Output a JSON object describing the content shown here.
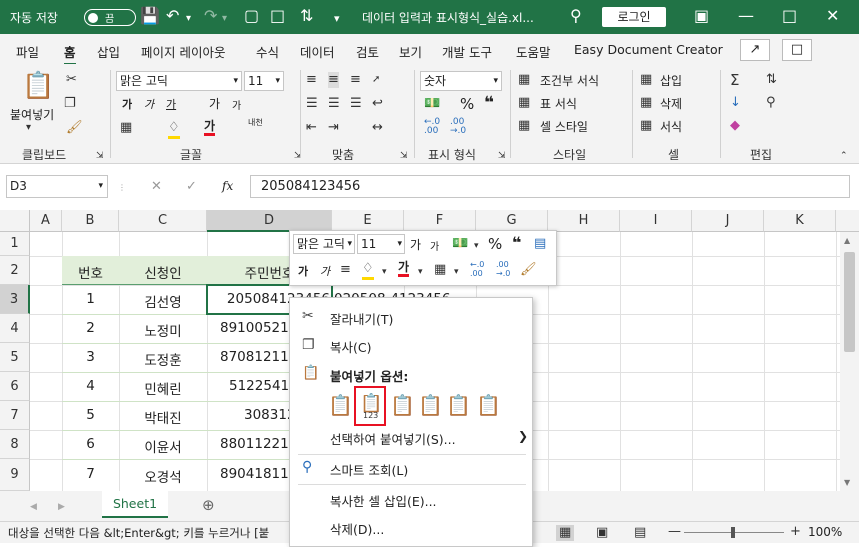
{
  "titlebar": {
    "autosave_label": "자동 저장",
    "autosave_state": "끔",
    "document_title": "데이터 입력과 표시형식_실습.xl...",
    "login_label": "로그인"
  },
  "menu": {
    "items": [
      "파일",
      "홈",
      "삽입",
      "페이지 레이아웃",
      "수식",
      "데이터",
      "검토",
      "보기",
      "개발 도구",
      "도움말",
      "Easy Document Creator"
    ],
    "active": "홈"
  },
  "ribbon": {
    "clipboard": {
      "paste_label": "붙여넣기",
      "group_label": "클립보드"
    },
    "font": {
      "font_name": "맑은 고딕",
      "font_size": "11",
      "group_label": "글꼴",
      "ga_label": "가",
      "phonetic_label": "내천"
    },
    "alignment": {
      "group_label": "맞춤"
    },
    "number": {
      "format": "숫자",
      "group_label": "표시 형식"
    },
    "styles": {
      "cond_format": "조건부 서식",
      "table_format": "표 서식",
      "cell_style": "셀 스타일",
      "group_label": "스타일"
    },
    "cells": {
      "insert": "삽입",
      "delete": "삭제",
      "format": "서식",
      "group_label": "셀"
    },
    "editing": {
      "group_label": "편집"
    }
  },
  "formula_bar": {
    "name_box": "D3",
    "fx_label": "fx",
    "value": "205084123456"
  },
  "columns": [
    "A",
    "B",
    "C",
    "D",
    "E",
    "F",
    "G",
    "H",
    "I",
    "J",
    "K"
  ],
  "rows": [
    "1",
    "2",
    "3",
    "4",
    "5",
    "6",
    "7",
    "8",
    "9"
  ],
  "table": {
    "headers": [
      "번호",
      "신청인",
      "주민번호"
    ],
    "data": [
      [
        "1",
        "김선영",
        "205084123456",
        "020508-4123456"
      ],
      [
        "2",
        "노정미",
        "891005212",
        ""
      ],
      [
        "3",
        "도정훈",
        "870812112",
        ""
      ],
      [
        "4",
        "민혜린",
        "51225412",
        ""
      ],
      [
        "5",
        "박태진",
        "308312",
        ""
      ],
      [
        "6",
        "이윤서",
        "880112212",
        ""
      ],
      [
        "7",
        "오경석",
        "890418112",
        ""
      ]
    ]
  },
  "mini_toolbar": {
    "font_name": "맑은 고딕",
    "font_size": "11"
  },
  "context_menu": {
    "cut": "잘라내기(T)",
    "copy": "복사(C)",
    "paste_options": "붙여넣기 옵션:",
    "paste_special": "선택하여 붙여넣기(S)...",
    "smart_lookup": "스마트 조회(L)",
    "insert_copied": "복사한 셀 삽입(E)...",
    "delete": "삭제(D)..."
  },
  "sheet_tab": "Sheet1",
  "status": {
    "message": "대상을 선택한 다음 &lt;Enter&gt; 키를 누르거나 [붙",
    "zoom": "100%"
  },
  "colors": {
    "accent": "#217346",
    "header_fill": "#e2efda",
    "highlight": "#e81123"
  }
}
